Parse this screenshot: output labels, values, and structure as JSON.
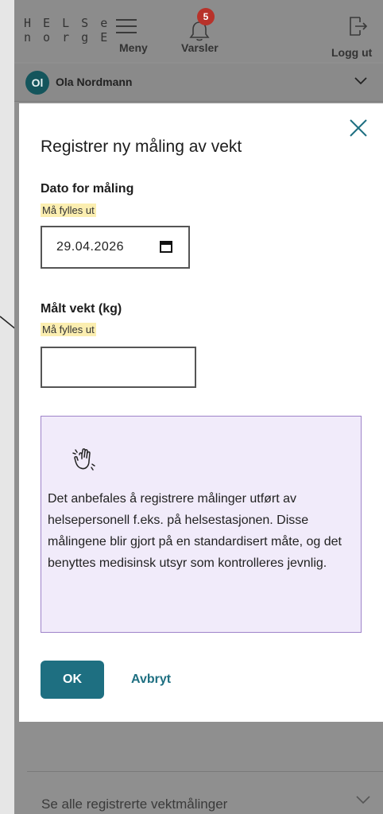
{
  "header": {
    "logo_line1": "H E L S e",
    "logo_line2": "n o r g E",
    "menu_label": "Meny",
    "notifications_label": "Varsler",
    "notifications_count": "5",
    "logout_label": "Logg ut"
  },
  "user": {
    "initials": "Ol",
    "name": "Ola Nordmann"
  },
  "modal": {
    "title": "Registrer ny måling av vekt",
    "date_label": "Dato for måling",
    "date_required": "Må fylles ut",
    "date_value": "29.04.2026",
    "weight_label": "Målt vekt (kg)",
    "weight_required": "Må fylles ut",
    "weight_value": "",
    "info_text": "Det anbefales å registrere målinger utført av helsepersonell f.eks. på helsestasjonen. Disse målingene blir gjort på en standardisert måte, og det benyttes medisinsk utsyr som kontrolleres jevnlig.",
    "ok_label": "OK",
    "cancel_label": "Avbryt"
  },
  "background": {
    "see_all_link": "Se alle registrerte vektmålinger"
  },
  "colors": {
    "primary": "#1e6f81",
    "badge": "#b8322a",
    "avatar": "#14555c",
    "info_bg": "#f1ebfa",
    "info_border": "#9e83c9",
    "required_bg": "#fbeeb0"
  }
}
